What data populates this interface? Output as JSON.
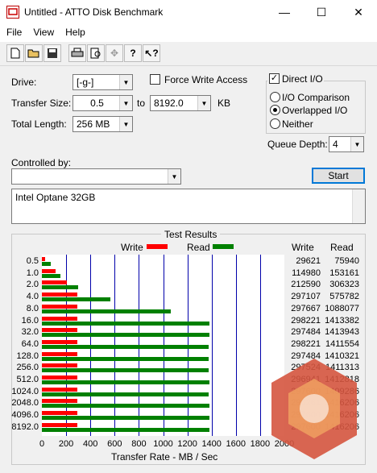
{
  "window": {
    "title": "Untitled - ATTO Disk Benchmark",
    "minimize": "—",
    "maximize": "☐",
    "close": "✕"
  },
  "menu": [
    "File",
    "View",
    "Help"
  ],
  "toolbar_icons": [
    "new-icon",
    "open-icon",
    "save-icon",
    "print-icon",
    "print-preview-icon",
    "move-icon",
    "about-icon",
    "help-icon"
  ],
  "form": {
    "drive_label": "Drive:",
    "drive_value": "[-g-]",
    "transfer_size_label": "Transfer Size:",
    "transfer_from": "0.5",
    "to_label": "to",
    "transfer_to": "8192.0",
    "kb_label": "KB",
    "total_length_label": "Total Length:",
    "total_length_value": "256 MB",
    "force_write_label": "Force Write Access",
    "force_write_checked": false,
    "direct_io_label": "Direct I/O",
    "direct_io_checked": true,
    "io_comparison_label": "I/O Comparison",
    "overlapped_io_label": "Overlapped I/O",
    "neither_label": "Neither",
    "selected_io": "Overlapped I/O",
    "queue_depth_label": "Queue Depth:",
    "queue_depth_value": "4",
    "controlled_by_label": "Controlled by:",
    "controlled_by_value": "",
    "start_label": "Start",
    "description": "Intel Optane 32GB"
  },
  "results": {
    "group_title": "Test Results",
    "legend_write": "Write",
    "legend_read": "Read",
    "col_write": "Write",
    "col_read": "Read",
    "xlabel": "Transfer Rate - MB / Sec",
    "colors": {
      "write": "#ff0000",
      "read": "#008000",
      "grid": "#0000aa"
    }
  },
  "chart_data": {
    "type": "bar",
    "orientation": "horizontal",
    "categories": [
      "0.5",
      "1.0",
      "2.0",
      "4.0",
      "8.0",
      "16.0",
      "32.0",
      "64.0",
      "128.0",
      "256.0",
      "512.0",
      "1024.0",
      "2048.0",
      "4096.0",
      "8192.0"
    ],
    "series": [
      {
        "name": "Write",
        "values": [
          29621,
          114980,
          212590,
          297107,
          297667,
          298221,
          297484,
          298221,
          297484,
          297524,
          296941,
          297600,
          298261,
          297600,
          297600
        ]
      },
      {
        "name": "Read",
        "values": [
          75940,
          153161,
          306323,
          575782,
          1088077,
          1413382,
          1413943,
          1411554,
          1410321,
          1411313,
          1412818,
          1409286,
          1416206,
          1416206,
          1416206
        ]
      }
    ],
    "xlabel": "Transfer Rate - MB / Sec",
    "xlim": [
      0,
      2000
    ],
    "xticks": [
      "0",
      "200",
      "400",
      "600",
      "800",
      "1000",
      "1200",
      "1400",
      "1600",
      "1800",
      "2000"
    ],
    "grid": true,
    "legend": "top"
  }
}
